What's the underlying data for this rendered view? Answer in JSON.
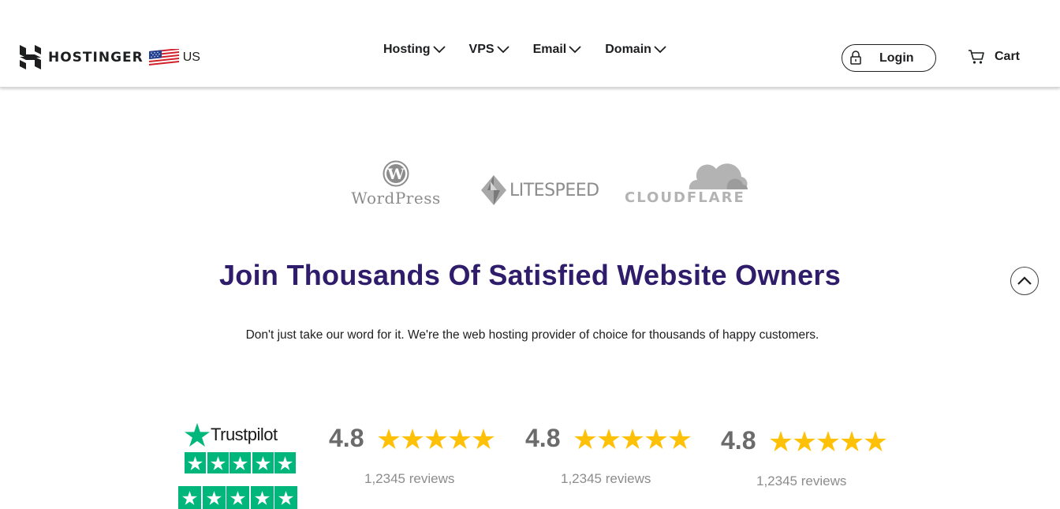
{
  "header": {
    "brand": "HOSTINGER",
    "country": "US",
    "nav": [
      {
        "label": "Hosting"
      },
      {
        "label": "VPS"
      },
      {
        "label": "Email"
      },
      {
        "label": "Domain"
      }
    ],
    "login_label": "Login",
    "cart_label": "Cart"
  },
  "partners": {
    "wordpress": "WordPress",
    "litespeed": "LITESPEED",
    "cloudflare": "CLOUDFLARE"
  },
  "main": {
    "headline": "Join Thousands Of Satisfied Website Owners",
    "subheadline": "Don't just take our word for it. We're the web hosting provider of choice for thousands of happy customers."
  },
  "trustpilot": {
    "name": "Trustpilot",
    "brand_color": "#00b67a"
  },
  "ratings": [
    {
      "score": "4.8",
      "stars": 5,
      "reviews": "1,2345 reviews"
    },
    {
      "score": "4.8",
      "stars": 5,
      "reviews": "1,2345 reviews"
    },
    {
      "score": "4.8",
      "stars": 5,
      "reviews": "1,2345 reviews"
    }
  ],
  "colors": {
    "headline": "#2f1c6a",
    "star": "#ffc107",
    "text": "#1d1e20"
  },
  "icons": {
    "logo": "hostinger-logo-icon",
    "flag": "us-flag-icon",
    "chevron": "chevron-down-icon",
    "lock": "lock-icon",
    "cart": "cart-icon",
    "scroll_top": "chevron-up-icon",
    "star": "star-icon"
  }
}
